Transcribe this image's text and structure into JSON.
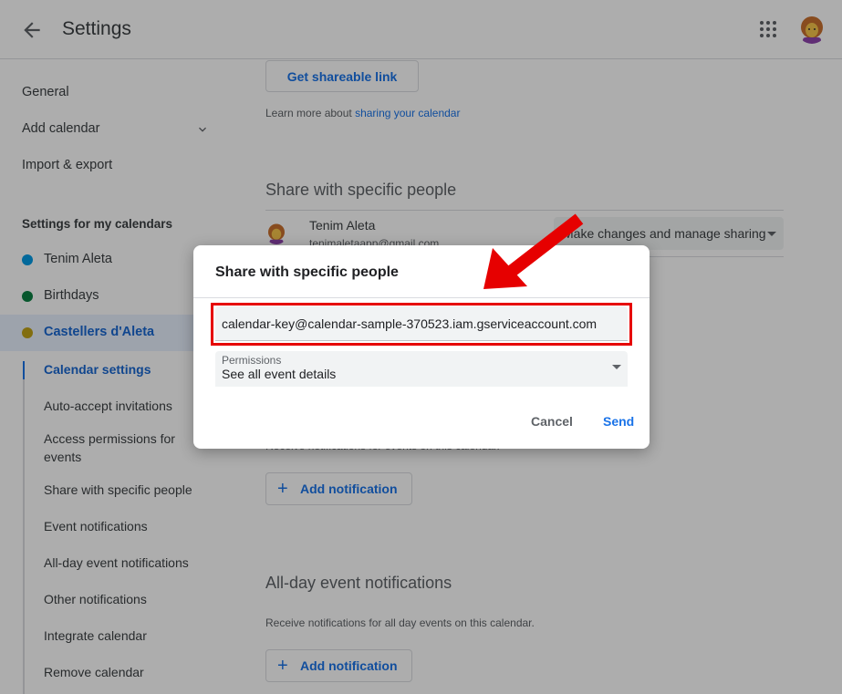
{
  "header": {
    "title": "Settings",
    "back_icon": "arrow-left-icon",
    "apps_icon": "apps-grid-icon"
  },
  "sidebar": {
    "general": "General",
    "add_calendar": "Add calendar",
    "import_export": "Import & export",
    "my_calendars_heading": "Settings for my calendars",
    "calendars": [
      {
        "label": "Tenim Aleta",
        "color": "#039be5"
      },
      {
        "label": "Birthdays",
        "color": "#0b8043"
      },
      {
        "label": "Castellers d'Aleta",
        "color": "#c0a318"
      }
    ],
    "sub_items": [
      "Calendar settings",
      "Auto-accept invitations",
      "Access permissions for events",
      "Share with specific people",
      "Event notifications",
      "All-day event notifications",
      "Other notifications",
      "Integrate calendar",
      "Remove calendar"
    ]
  },
  "main": {
    "get_link_button": "Get shareable link",
    "learn_more_prefix": "Learn more about ",
    "learn_more_link": "sharing your calendar",
    "share_title": "Share with specific people",
    "person_name": "Tenim Aleta",
    "person_email": "tenimaletaapp@gmail.com",
    "person_permission": "Make changes and manage sharing",
    "event_notif_desc": "Receive notifications for events on this calendar.",
    "add_notification": "Add notification",
    "allday_title": "All-day event notifications",
    "allday_desc": "Receive notifications for all day events on this calendar.",
    "add_notification_2": "Add notification"
  },
  "dialog": {
    "title": "Share with specific people",
    "email_value": "calendar-key@calendar-sample-370523.iam.gserviceaccount.com",
    "permissions_label": "Permissions",
    "permissions_value": "See all event details",
    "cancel": "Cancel",
    "send": "Send"
  },
  "colors": {
    "accent": "#1a73e8",
    "annotation": "#e60000"
  }
}
